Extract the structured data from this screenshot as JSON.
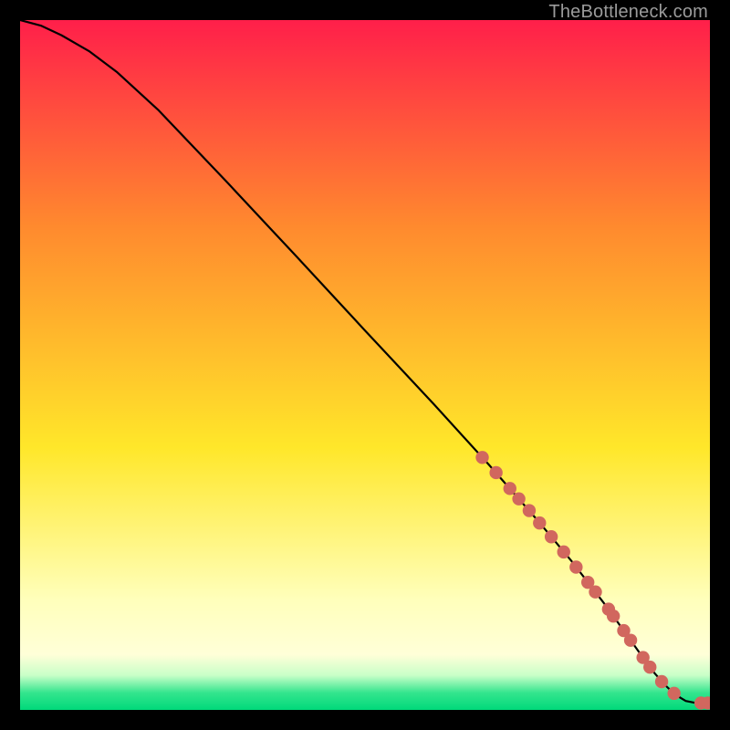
{
  "attribution": "TheBottleneck.com",
  "colors": {
    "top": "#ff1f4a",
    "mid_upper": "#ff8a2e",
    "mid_yellow": "#ffe72a",
    "pale_yellow": "#ffffbb",
    "green_top": "#8bff8b",
    "green": "#00d97a",
    "curve": "#000000",
    "dot": "#d1675e",
    "page_bg": "#000000"
  },
  "chart_data": {
    "type": "line",
    "title": "",
    "xlabel": "",
    "ylabel": "",
    "xlim": [
      0,
      100
    ],
    "ylim": [
      0,
      100
    ],
    "curve": {
      "x": [
        0,
        3,
        6,
        10,
        14,
        20,
        30,
        40,
        50,
        60,
        68,
        75,
        80,
        85,
        88,
        90,
        92,
        93.5,
        95,
        96.5,
        98,
        100
      ],
      "y": [
        100,
        99.2,
        97.8,
        95.5,
        92.5,
        87,
        76.5,
        65.8,
        55,
        44.3,
        35.5,
        27.5,
        21.5,
        15,
        10.8,
        8.0,
        5.3,
        3.6,
        2.2,
        1.3,
        1.0,
        1.0
      ]
    },
    "series": [
      {
        "name": "data-points",
        "x": [
          67,
          69,
          71,
          72.3,
          73.8,
          75.3,
          77,
          78.8,
          80.6,
          82.3,
          83.4,
          85.3,
          86,
          87.5,
          88.5,
          90.3,
          91.3,
          93,
          94.8,
          98.7,
          99.7
        ],
        "y": [
          36.6,
          34.4,
          32.1,
          30.6,
          28.9,
          27.1,
          25.1,
          22.9,
          20.7,
          18.5,
          17.1,
          14.6,
          13.6,
          11.5,
          10.1,
          7.6,
          6.2,
          4.1,
          2.4,
          1.0,
          1.0
        ]
      }
    ]
  }
}
